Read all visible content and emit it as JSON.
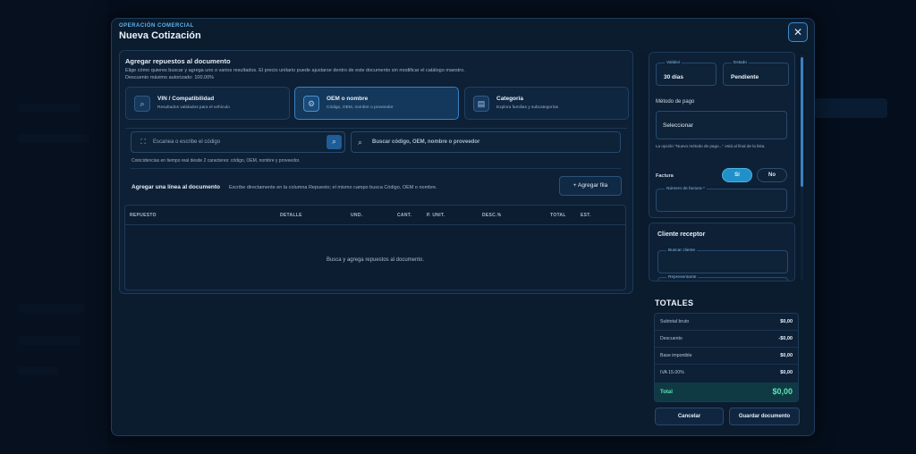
{
  "modal": {
    "eyebrow": "OPERACIÓN COMERCIAL",
    "title": "Nueva Cotización",
    "close_glyph": "✕"
  },
  "add_parts": {
    "heading": "Agregar repuestos al documento",
    "description_line1": "Elige cómo quieres buscar y agrega uno o varios resultados. El precio unitario puede ajustarse dentro de este documento sin modificar el catálogo maestro.",
    "description_line2": "Descuento máximo autorizado: 100.00%",
    "modes": [
      {
        "title": "VIN / Compatibilidad",
        "subtitle": "Resultados validados para el vehículo",
        "icon": "search-icon",
        "glyph": "⌕"
      },
      {
        "title": "OEM o nombre",
        "subtitle": "Código, OEM, nombre o proveedor",
        "icon": "parts-icon",
        "glyph": "⚙"
      },
      {
        "title": "Categoría",
        "subtitle": "Explora familias y subcategorías",
        "icon": "category-icon",
        "glyph": "▤"
      }
    ],
    "active_mode": 1,
    "scan_placeholder": "Escanea o escribe el código",
    "query_placeholder": "Buscar código, OEM, nombre o proveedor",
    "hint": "Coincidencias en tiempo real desde 2 caracteres: código, OEM, nombre y proveedor.",
    "add_line_title": "Agregar una línea al documento",
    "add_line_desc": "Escribe directamente en la columna Repuesto; el mismo campo busca Código, OEM o nombre.",
    "add_row_label": "+  Agregar fila"
  },
  "table": {
    "columns": [
      "REPUESTO",
      "DETALLE",
      "UND.",
      "CANT.",
      "P. UNIT.",
      "DESC.%",
      "TOTAL",
      "EST."
    ],
    "empty_message": "Busca y agrega repuestos al documento."
  },
  "document": {
    "validity_label": "Validez",
    "validity_value": "30 días",
    "status_label": "Estado",
    "status_value": "Pendiente",
    "payment_label": "Método de pago",
    "payment_value": "Seleccionar",
    "payment_note": "La opción \"Nuevo método de pago...\" está al final de la lista.",
    "invoice_label": "Factura",
    "invoice_yes": "Sí",
    "invoice_no": "No",
    "invoice_number_label": "Número de factura *"
  },
  "client": {
    "heading": "Cliente receptor",
    "search_label": "Buscar cliente",
    "representative_label": "Representante"
  },
  "totals": {
    "title": "TOTALES",
    "rows": [
      {
        "label": "Subtotal bruto",
        "value": "$0,00"
      },
      {
        "label": "Descuento",
        "value": "-$0,00"
      },
      {
        "label": "Base imponible",
        "value": "$0,00"
      },
      {
        "label": "IVA 15.00%",
        "value": "$0,00"
      }
    ],
    "total_label": "Total",
    "total_value": "$0,00"
  },
  "footer": {
    "cancel_label": "Cancelar",
    "save_label": "Guardar documento"
  }
}
